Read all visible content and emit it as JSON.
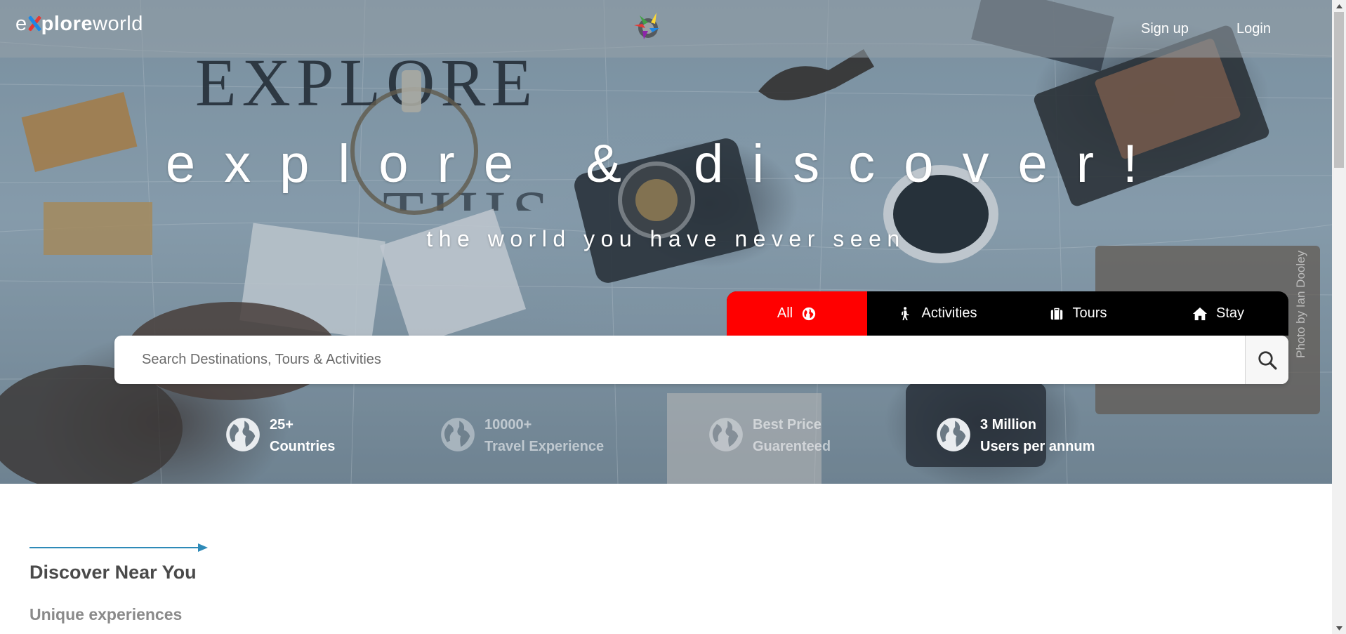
{
  "nav": {
    "logo_prefix": "e",
    "logo_bold": "plore",
    "logo_rest": "world",
    "signup": "Sign up",
    "login": "Login"
  },
  "hero": {
    "headline": "explore & discover!",
    "subheadline": "the world you have never seen",
    "photo_credit": "Photo by  Ian Dooley",
    "background_print_word": "EXPLORE",
    "background_print_word2": "THIS"
  },
  "tabs": [
    {
      "label": "All",
      "icon": "globe-icon",
      "active": true
    },
    {
      "label": "Activities",
      "icon": "hiker-icon",
      "active": false
    },
    {
      "label": "Tours",
      "icon": "suitcase-icon",
      "active": false
    },
    {
      "label": "Stay",
      "icon": "home-icon",
      "active": false
    }
  ],
  "search": {
    "placeholder": "Search Destinations, Tours & Activities"
  },
  "stats": [
    {
      "value": "25+",
      "label": "Countries"
    },
    {
      "value": "10000+",
      "label": "Travel Experience"
    },
    {
      "value": "Best Price",
      "label": "Guarenteed"
    },
    {
      "value": "3 Million",
      "label": "Users per annum"
    }
  ],
  "section": {
    "title": "Discover Near You",
    "subtitle": "Unique experiences"
  },
  "colors": {
    "active_tab": "#ff0000",
    "tab_bar": "#000000",
    "accent_arrow": "#2e8ab8"
  }
}
